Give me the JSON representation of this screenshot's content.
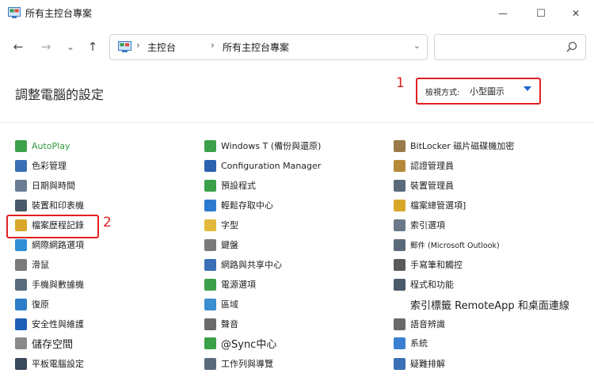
{
  "window": {
    "title": "所有主控台專案",
    "minimize_glyph": "—",
    "maximize_glyph": "☐",
    "close_glyph": "✕"
  },
  "nav": {
    "back_glyph": "←",
    "forward_glyph": "→",
    "recent_glyph": "⌄",
    "up_glyph": "↑",
    "breadcrumb": [
      "主控台",
      "所有主控台專案"
    ],
    "separator": "›",
    "address_dropdown_glyph": "⌄",
    "refresh_glyph": "↻",
    "search_placeholder": ""
  },
  "main": {
    "heading": "調整電腦的設定",
    "view_by": {
      "label": "檢視方式:",
      "value": "小型圖示"
    },
    "annotations": [
      "1",
      "2"
    ]
  },
  "columns": [
    [
      {
        "label": "AutoPlay",
        "icon": "autoplay-icon",
        "color": "#3aa14a"
      },
      {
        "label": "色彩管理",
        "icon": "color-management-icon",
        "color": "#3a6fb5"
      },
      {
        "label": "日期與時間",
        "icon": "date-time-icon",
        "color": "#6b7c93"
      },
      {
        "label": "裝置和印表機",
        "icon": "devices-printers-icon",
        "color": "#4a5a6a"
      },
      {
        "label": "檔案歷程記錄",
        "icon": "file-history-icon",
        "color": "#d9a72a"
      },
      {
        "label": "網際網路選項",
        "icon": "internet-options-icon",
        "color": "#2f8fd6"
      },
      {
        "label": "滑鼠",
        "icon": "mouse-icon",
        "color": "#7a7a7a"
      },
      {
        "label": "手機與數據機",
        "icon": "phone-modem-icon",
        "color": "#5a6a7a"
      },
      {
        "label": "復原",
        "icon": "recovery-icon",
        "color": "#2e7fc9"
      },
      {
        "label": "安全性與維護",
        "icon": "security-flag-icon",
        "color": "#1d5fb8"
      },
      {
        "label": "儲存空間",
        "icon": "storage-spaces-icon",
        "color": "#8a8a8a"
      },
      {
        "label": "平板電腦設定",
        "icon": "tablet-settings-icon",
        "color": "#3a4a5a"
      }
    ],
    [
      {
        "label": "Windows T (備份與還原)",
        "icon": "backup-restore-icon",
        "color": "#3aa14a"
      },
      {
        "label": "Configuration Manager",
        "icon": "configuration-manager-icon",
        "color": "#2a62b0"
      },
      {
        "label": "預設程式",
        "icon": "default-programs-icon",
        "color": "#3aa14a"
      },
      {
        "label": "輕鬆存取中心",
        "icon": "ease-of-access-icon",
        "color": "#2b7ad0"
      },
      {
        "label": "字型",
        "icon": "fonts-icon",
        "color": "#e2b93b"
      },
      {
        "label": "鍵盤",
        "icon": "keyboard-icon",
        "color": "#7a7a7a"
      },
      {
        "label": "網路與共享中心",
        "icon": "network-sharing-icon",
        "color": "#3b6fb6"
      },
      {
        "label": "電源選項",
        "icon": "power-options-icon",
        "color": "#3aa14a"
      },
      {
        "label": "區域",
        "icon": "region-icon",
        "color": "#3a8fd0"
      },
      {
        "label": "聲音",
        "icon": "sound-icon",
        "color": "#6a6a6a"
      },
      {
        "label": "@Sync中心",
        "icon": "sync-center-icon",
        "color": "#3aa14a"
      },
      {
        "label": "工作列與導覽",
        "icon": "taskbar-navigation-icon",
        "color": "#5a6a7a"
      }
    ],
    [
      {
        "label": "BitLocker 磁片磁碟機加密",
        "icon": "bitlocker-icon",
        "color": "#9a7a4a"
      },
      {
        "label": "認證管理員",
        "icon": "credential-manager-icon",
        "color": "#b48a3a"
      },
      {
        "label": "裝置管理員",
        "icon": "device-manager-icon",
        "color": "#5a6a7a"
      },
      {
        "label": "檔案總管選項]",
        "icon": "file-explorer-options-icon",
        "color": "#d9a72a"
      },
      {
        "label": "索引選項",
        "icon": "indexing-options-icon",
        "color": "#6a7a8a"
      },
      {
        "label": "郵件 (Microsoft Outlook)",
        "icon": "mail-icon",
        "color": "#5a6a7a"
      },
      {
        "label": "手寫筆和觸控",
        "icon": "pen-touch-icon",
        "color": "#5a5a5a"
      },
      {
        "label": "程式和功能",
        "icon": "programs-features-icon",
        "color": "#4a5a6a"
      },
      {
        "label": "索引標籤 RemoteApp 和桌面連線",
        "icon": "remoteapp-icon",
        "color": "#ffffff"
      },
      {
        "label": "語音辨識",
        "icon": "speech-recognition-icon",
        "color": "#6a6a6a"
      },
      {
        "label": "系統",
        "icon": "system-icon",
        "color": "#3b7fd0"
      },
      {
        "label": "疑難排解",
        "icon": "troubleshooting-icon",
        "color": "#3b6fb6"
      }
    ]
  ],
  "colors": {
    "annotation": "#e02020",
    "accent": "#1a67d2",
    "link_green": "#2e9b3a"
  }
}
